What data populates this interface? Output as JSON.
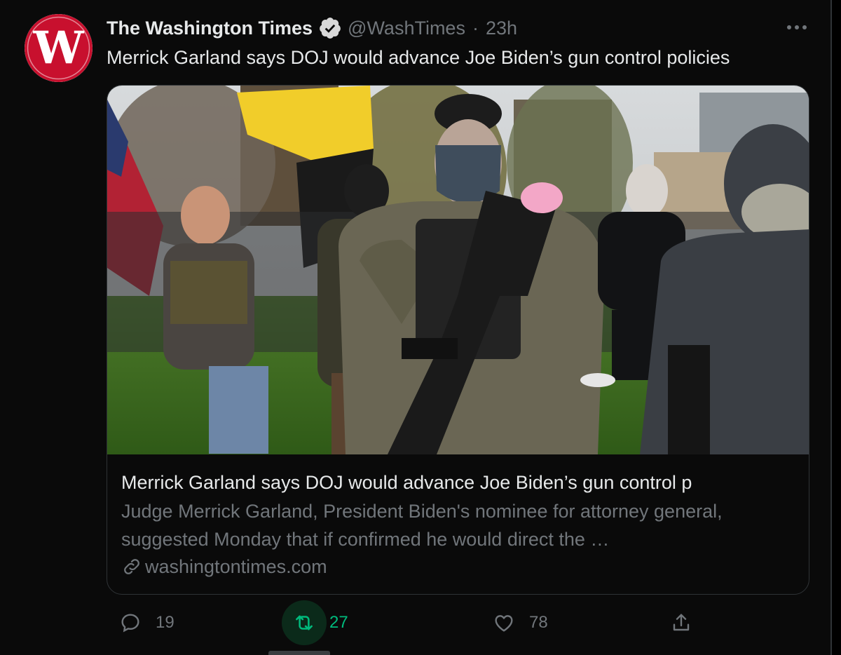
{
  "tweet": {
    "display_name": "The Washington Times",
    "verified": true,
    "handle": "@WashTimes",
    "separator": "·",
    "time": "23h",
    "text": "Merrick Garland says DOJ would advance Joe Biden’s gun control policies",
    "avatar_letter": "W"
  },
  "card": {
    "image_alt": "photo",
    "title": "Merrick Garland says DOJ would advance Joe Biden’s gun control p",
    "description": "Judge Merrick Garland, President Biden's nominee for attorney general, suggested Monday that if confirmed he would direct the …",
    "domain": "washingtontimes.com"
  },
  "actions": {
    "reply_count": "19",
    "retweet_count": "27",
    "like_count": "78",
    "retweet_active": true
  },
  "colors": {
    "background": "#0a0a0a",
    "text_primary": "#e7e9ea",
    "text_secondary": "#71767b",
    "border": "#2f3336",
    "retweet_green": "#00ba7c",
    "logo_red": "#c8102e"
  },
  "icons": {
    "verified": "verified-badge-icon",
    "more": "more-dots-icon",
    "link": "link-icon",
    "reply": "reply-icon",
    "retweet": "retweet-icon",
    "like": "heart-icon",
    "share": "share-icon"
  }
}
